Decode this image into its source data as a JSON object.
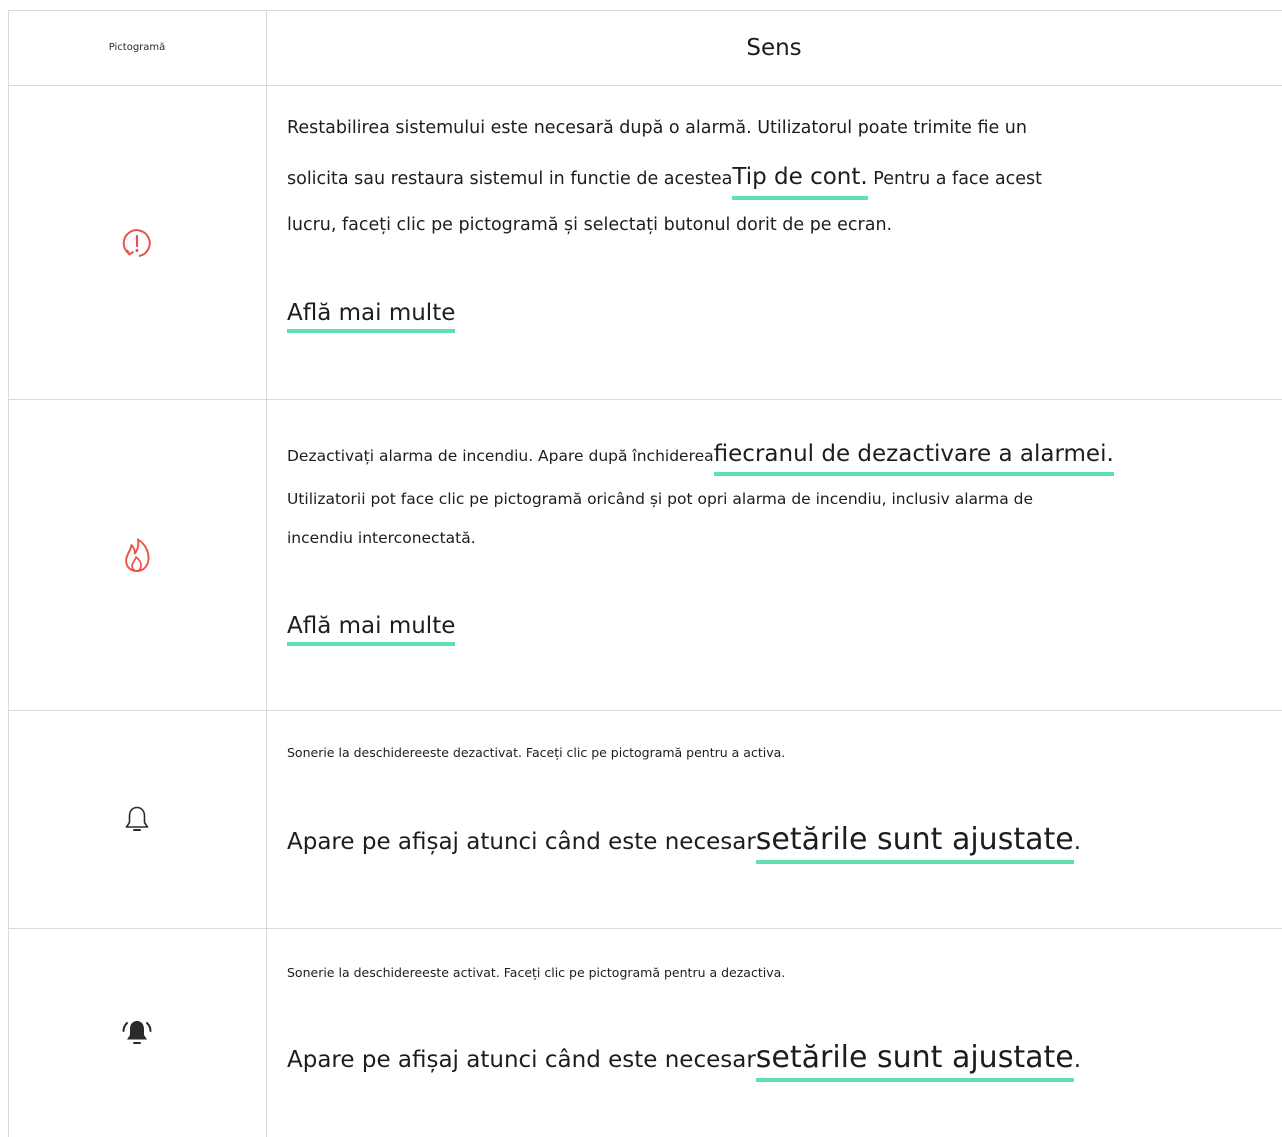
{
  "header": {
    "icon_col": "Pictogramă",
    "meaning_col": "Sens"
  },
  "rows": [
    {
      "icon": "alarm-restore-icon",
      "icon_color": "#e8534a",
      "line1": "Restabilirea sistemului este necesară după o alarmă. Utilizatorul poate trimite fie un",
      "line2_a": "solicita sau restaura sistemul in functie de acestea",
      "line2_link": "Tip de cont.",
      "line2_b": " Pentru a face acest",
      "line3": "lucru, faceți clic pe pictogramă și selectați butonul dorit de pe ecran.",
      "more": "Află mai multe"
    },
    {
      "icon": "fire-icon",
      "icon_color": "#e8534a",
      "line1_a": "Dezactivați alarma de incendiu. Apare după închiderea",
      "line1_link": "fiecranul de dezactivare a alarmei.",
      "line2": "Utilizatorii pot face clic pe pictogramă oricând și pot opri alarma de incendiu, inclusiv alarma de",
      "line3": "incendiu interconectată.",
      "more": "Află mai multe"
    },
    {
      "icon": "bell-icon",
      "icon_color": "#2b2b2b",
      "line1": "Sonerie la deschidereeste dezactivat. Faceți clic pe pictogramă pentru a activa.",
      "line2_a": "Apare pe afișaj atunci când este necesar",
      "line2_link": "setările sunt ajustate",
      "line2_b": "."
    },
    {
      "icon": "bell-ringing-icon",
      "icon_color": "#2b2b2b",
      "line1": "Sonerie la deschidereeste activat. Faceți clic pe pictogramă pentru a dezactiva.",
      "line2_a": "Apare pe afișaj atunci când este necesar",
      "line2_link": "setările sunt ajustate",
      "line2_b": "."
    }
  ],
  "colors": {
    "border": "#d9d9d9",
    "link_underline": "#5fe0ac"
  }
}
